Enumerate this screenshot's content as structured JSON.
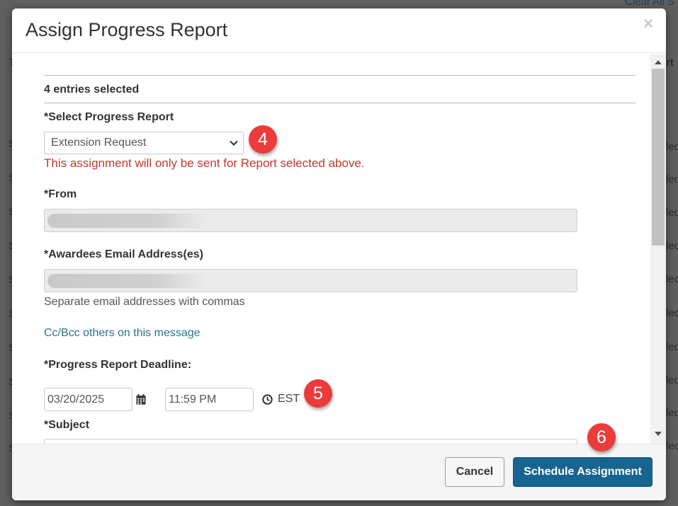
{
  "background": {
    "top_link": "Clear All S",
    "right_column_partial": [
      "rt",
      "lec",
      "lec",
      "lec",
      "lec",
      "lec",
      "lec",
      "lec",
      "lec",
      "lec",
      "lec"
    ],
    "left_column_partial": [
      "T",
      "S",
      "S",
      "S",
      "S",
      "S",
      "S",
      "S",
      "S",
      "S",
      "S",
      "S"
    ]
  },
  "modal": {
    "title": "Assign Progress Report",
    "close_glyph": "×",
    "entries_selected": "4 entries selected",
    "progress_report": {
      "label": "*Select Progress Report",
      "value": "Extension Request",
      "warning": "This assignment will only be sent for Report selected above."
    },
    "from": {
      "label": "*From",
      "value": ""
    },
    "awardees": {
      "label": "*Awardees Email Address(es)",
      "value": "",
      "help": "Separate email addresses with commas"
    },
    "cc_link": "Cc/Bcc others on this message",
    "deadline": {
      "label": "*Progress Report Deadline:",
      "date": "03/20/2025",
      "time": "11:59 PM",
      "timezone": "EST"
    },
    "subject": {
      "label": "*Subject",
      "value": ""
    },
    "footer": {
      "cancel_label": "Cancel",
      "schedule_label": "Schedule Assignment"
    }
  },
  "annotations": [
    "4",
    "5",
    "6"
  ],
  "colors": {
    "warning_text": "#c0392b",
    "link": "#2a7488",
    "primary_button": "#166590",
    "badge": "#ec3b3b"
  },
  "icons": [
    "close-icon",
    "chevron-down-icon",
    "calendar-icon",
    "clock-icon",
    "scroll-up-arrow-icon",
    "scroll-down-arrow-icon"
  ]
}
